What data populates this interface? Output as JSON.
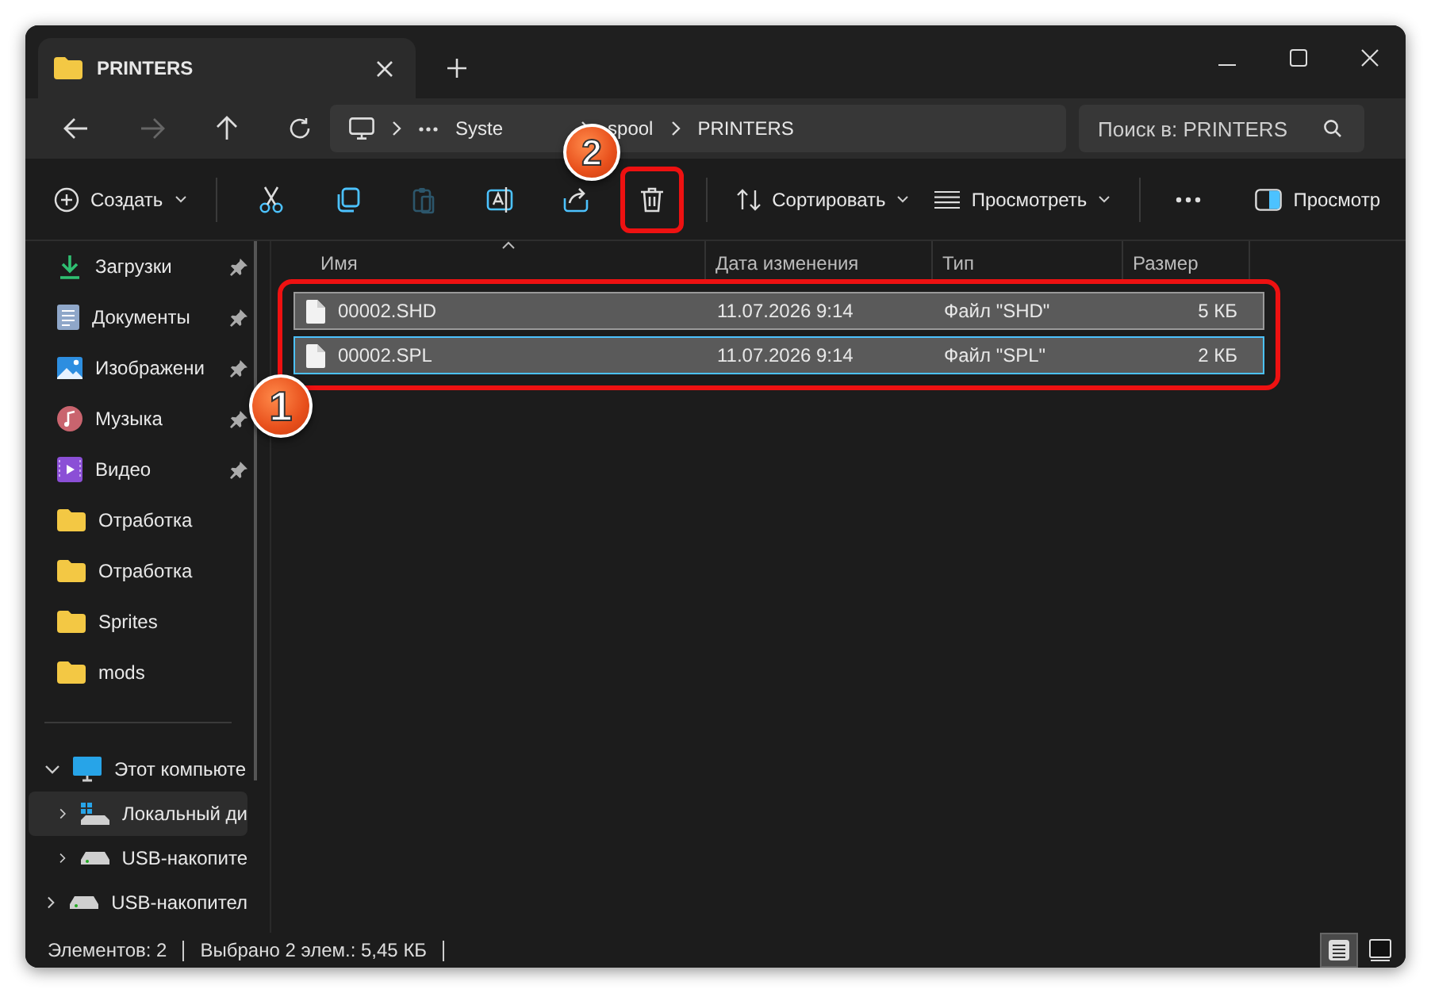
{
  "tab": {
    "title": "PRINTERS"
  },
  "address": {
    "crumbs": [
      "Syste",
      "spool",
      "PRINTERS"
    ]
  },
  "search": {
    "placeholder": "Поиск в: PRINTERS"
  },
  "toolbar": {
    "create": {
      "label": "Создать"
    },
    "actions": [
      {
        "kind": "cut",
        "disabled": false,
        "highlighted": false
      },
      {
        "kind": "copy",
        "disabled": false,
        "highlighted": false
      },
      {
        "kind": "paste",
        "disabled": true,
        "highlighted": false
      },
      {
        "kind": "rename",
        "disabled": false,
        "highlighted": false
      },
      {
        "kind": "share",
        "disabled": false,
        "highlighted": false
      },
      {
        "kind": "delete",
        "disabled": false,
        "highlighted": true
      }
    ],
    "sort": {
      "label": "Сортировать"
    },
    "view": {
      "label": "Просмотреть"
    },
    "preview": {
      "label": "Просмотр"
    }
  },
  "sidebar": {
    "quick_access": [
      {
        "label": "Загрузки",
        "kind": "downloads",
        "pinned": true
      },
      {
        "label": "Документы",
        "kind": "documents",
        "pinned": true
      },
      {
        "label": "Изображени",
        "kind": "pictures",
        "pinned": true
      },
      {
        "label": "Музыка",
        "kind": "music",
        "pinned": true
      },
      {
        "label": "Видео",
        "kind": "videos",
        "pinned": true
      },
      {
        "label": "Отработка",
        "kind": "folder",
        "pinned": false
      },
      {
        "label": "Отработка",
        "kind": "folder",
        "pinned": false
      },
      {
        "label": "Sprites",
        "kind": "folder",
        "pinned": false
      },
      {
        "label": "mods",
        "kind": "folder",
        "pinned": false
      }
    ],
    "tree": [
      {
        "label": "Этот компьюте",
        "kind": "pc",
        "expanded": true,
        "selected": false,
        "children": [
          {
            "label": "Локальный ди",
            "kind": "system-drive",
            "expanded": false,
            "selected": true
          },
          {
            "label": "USB-накопите",
            "kind": "drive",
            "expanded": false,
            "selected": false
          }
        ]
      },
      {
        "label": "USB-накопител",
        "kind": "drive",
        "expanded": false,
        "selected": false
      }
    ]
  },
  "file_list": {
    "highlighted": true,
    "columns": [
      {
        "label": "Имя",
        "sorted": true
      },
      {
        "label": "Дата изменения",
        "sorted": false
      },
      {
        "label": "Тип",
        "sorted": false
      },
      {
        "label": "Размер",
        "sorted": false
      }
    ],
    "rows": [
      {
        "name": "00002.SHD",
        "date": "11.07.2026 9:14",
        "type": "Файл \"SHD\"",
        "size": "5 КБ",
        "selected": true,
        "focused": false
      },
      {
        "name": "00002.SPL",
        "date": "11.07.2026 9:14",
        "type": "Файл \"SPL\"",
        "size": "2 КБ",
        "selected": true,
        "focused": true
      }
    ]
  },
  "status_bar": {
    "items": [
      "Элементов: 2",
      "Выбрано 2 элем.: 5,45 КБ"
    ],
    "views": [
      {
        "kind": "details",
        "selected": true
      },
      {
        "kind": "tiles",
        "selected": false
      }
    ]
  },
  "callouts": [
    {
      "number": "1"
    },
    {
      "number": "2"
    }
  ]
}
